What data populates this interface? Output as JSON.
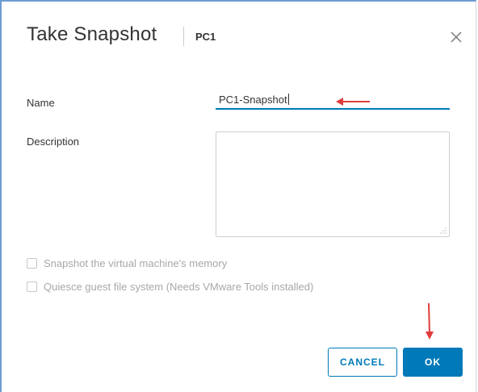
{
  "dialog": {
    "title": "Take Snapshot",
    "subtitle": "PC1",
    "close_icon": "close-icon"
  },
  "form": {
    "name_label": "Name",
    "name_value": "PC1-Snapshot",
    "description_label": "Description",
    "description_value": "",
    "options": [
      {
        "label": "Snapshot the virtual machine's memory",
        "checked": false,
        "disabled": true
      },
      {
        "label": "Quiesce guest file system (Needs VMware Tools installed)",
        "checked": false,
        "disabled": true
      }
    ]
  },
  "buttons": {
    "cancel_label": "CANCEL",
    "ok_label": "OK"
  },
  "colors": {
    "accent": "#0079b8",
    "annotation_arrow": "#e03c3c",
    "disabled_text": "#a8a8a8"
  }
}
